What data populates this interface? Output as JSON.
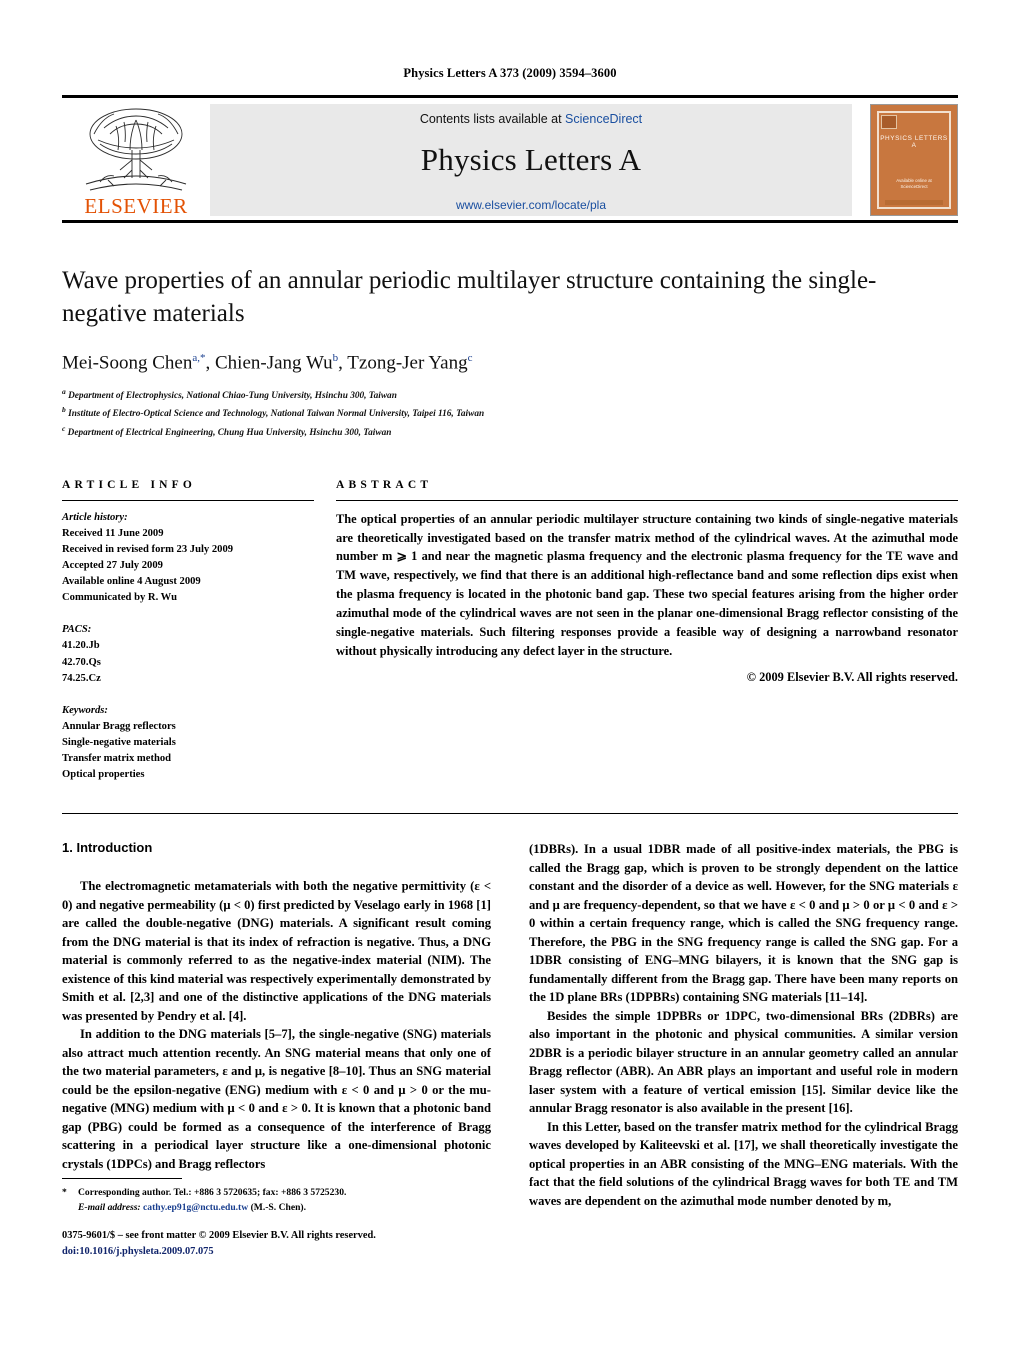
{
  "running_head": "Physics Letters A 373 (2009) 3594–3600",
  "masthead": {
    "elsevier_wordmark": "ELSEVIER",
    "contents_prefix": "Contents lists available at ",
    "sciencedirect": "ScienceDirect",
    "journal_name": "Physics Letters A",
    "journal_url": "www.elsevier.com/locate/pla",
    "cover_title": "PHYSICS LETTERS A",
    "cover_sd_line1": "Available online at",
    "cover_sd_line2": "ScienceDirect",
    "cover_sd_line3": "www.elsevier.com/locate/pla"
  },
  "title": "Wave properties of an annular periodic multilayer structure containing the single-negative materials",
  "authors": [
    {
      "name": "Mei-Soong Chen",
      "sup": "a,*"
    },
    {
      "name": "Chien-Jang Wu",
      "sup": "b"
    },
    {
      "name": "Tzong-Jer Yang",
      "sup": "c"
    }
  ],
  "affiliations": [
    {
      "mark": "a",
      "text": "Department of Electrophysics, National Chiao-Tung University, Hsinchu 300, Taiwan"
    },
    {
      "mark": "b",
      "text": "Institute of Electro-Optical Science and Technology, National Taiwan Normal University, Taipei 116, Taiwan"
    },
    {
      "mark": "c",
      "text": "Department of Electrical Engineering, Chung Hua University, Hsinchu 300, Taiwan"
    }
  ],
  "article_info": {
    "heading": "ARTICLE INFO",
    "history_label": "Article history:",
    "history": [
      "Received 11 June 2009",
      "Received in revised form 23 July 2009",
      "Accepted 27 July 2009",
      "Available online 4 August 2009",
      "Communicated by R. Wu"
    ],
    "pacs_label": "PACS:",
    "pacs": [
      "41.20.Jb",
      "42.70.Qs",
      "74.25.Cz"
    ],
    "keywords_label": "Keywords:",
    "keywords": [
      "Annular Bragg reflectors",
      "Single-negative materials",
      "Transfer matrix method",
      "Optical properties"
    ]
  },
  "abstract": {
    "heading": "ABSTRACT",
    "text": "The optical properties of an annular periodic multilayer structure containing two kinds of single-negative materials are theoretically investigated based on the transfer matrix method of the cylindrical waves. At the azimuthal mode number m ⩾ 1 and near the magnetic plasma frequency and the electronic plasma frequency for the TE wave and TM wave, respectively, we find that there is an additional high-reflectance band and some reflection dips exist when the plasma frequency is located in the photonic band gap. These two special features arising from the higher order azimuthal mode of the cylindrical waves are not seen in the planar one-dimensional Bragg reflector consisting of the single-negative materials. Such filtering responses provide a feasible way of designing a narrowband resonator without physically introducing any defect layer in the structure.",
    "copyright": "© 2009 Elsevier B.V. All rights reserved."
  },
  "body": {
    "section_number_title": "1. Introduction",
    "left_paragraphs": [
      "The electromagnetic metamaterials with both the negative permittivity (ε < 0) and negative permeability (μ < 0) first predicted by Veselago early in 1968 [1] are called the double-negative (DNG) materials. A significant result coming from the DNG material is that its index of refraction is negative. Thus, a DNG material is commonly referred to as the negative-index material (NIM). The existence of this kind material was respectively experimentally demonstrated by Smith et al. [2,3] and one of the distinctive applications of the DNG materials was presented by Pendry et al. [4].",
      "In addition to the DNG materials [5–7], the single-negative (SNG) materials also attract much attention recently. An SNG material means that only one of the two material parameters, ε and μ, is negative [8–10]. Thus an SNG material could be the epsilon-negative (ENG) medium with ε < 0 and μ > 0 or the mu-negative (MNG) medium with μ < 0 and ε > 0. It is known that a photonic band gap (PBG) could be formed as a consequence of the interference of Bragg scattering in a periodical layer structure like a one-dimensional photonic crystals (1DPCs) and Bragg reflectors"
    ],
    "right_paragraphs": [
      "(1DBRs). In a usual 1DBR made of all positive-index materials, the PBG is called the Bragg gap, which is proven to be strongly dependent on the lattice constant and the disorder of a device as well. However, for the SNG materials ε and μ are frequency-dependent, so that we have ε < 0 and μ > 0 or μ < 0 and ε > 0 within a certain frequency range, which is called the SNG frequency range. Therefore, the PBG in the SNG frequency range is called the SNG gap. For a 1DBR consisting of ENG–MNG bilayers, it is known that the SNG gap is fundamentally different from the Bragg gap. There have been many reports on the 1D plane BRs (1DPBRs) containing SNG materials [11–14].",
      "Besides the simple 1DPBRs or 1DPC, two-dimensional BRs (2DBRs) are also important in the photonic and physical communities. A similar version 2DBR is a periodic bilayer structure in an annular geometry called an annular Bragg reflector (ABR). An ABR plays an important and useful role in modern laser system with a feature of vertical emission [15]. Similar device like the annular Bragg resonator is also available in the present [16].",
      "In this Letter, based on the transfer matrix method for the cylindrical Bragg waves developed by Kaliteevski et al. [17], we shall theoretically investigate the optical properties in an ABR consisting of the MNG–ENG materials. With the fact that the field solutions of the cylindrical Bragg waves for both TE and TM waves are dependent on the azimuthal mode number denoted by m,"
    ]
  },
  "footnote": {
    "star": "*",
    "corresponding": "Corresponding author. Tel.: +886 3 5720635; fax: +886 3 5725230.",
    "email_label": "E-mail address:",
    "email": "cathy.ep91g@nctu.edu.tw",
    "email_owner": "(M.-S. Chen)."
  },
  "imprint": {
    "line1": "0375-9601/$ – see front matter © 2009 Elsevier B.V. All rights reserved.",
    "doi": "doi:10.1016/j.physleta.2009.07.075"
  },
  "colors": {
    "link_blue": "#1a4fa0",
    "ref_blue": "#1a3f8f",
    "elsevier_orange": "#E35205",
    "banner_gray": "#e9e9e9",
    "cover_orange": "#C8773F"
  }
}
